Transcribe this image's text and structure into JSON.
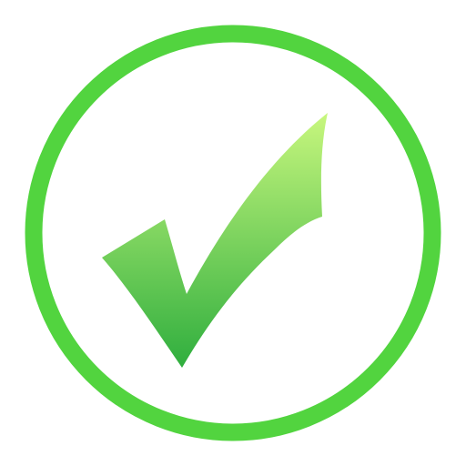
{
  "icon": {
    "name": "checkmark-in-circle",
    "ring_color": "#52d43f",
    "check_color_top": "#c8f77e",
    "check_color_bottom": "#2fae3e",
    "background": "#ffffff"
  }
}
